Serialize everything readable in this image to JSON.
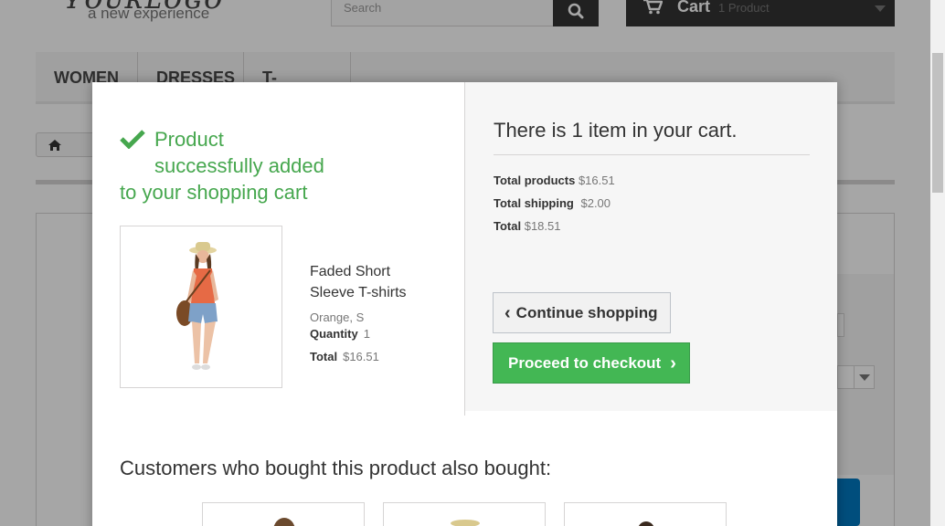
{
  "header": {
    "logo_tagline": "a new experience",
    "search_placeholder": "Search",
    "cart_label": "Cart",
    "cart_count": "1 Product"
  },
  "menu": {
    "items": [
      {
        "label": "WOMEN"
      },
      {
        "label": "DRESSES"
      },
      {
        "label": "T-SHIRTS"
      }
    ]
  },
  "modal": {
    "success_line1": "Product",
    "success_line1b": "successfully added",
    "success_line2": "to your shopping cart",
    "product": {
      "name": "Faded Short Sleeve T-shirts",
      "attributes": "Orange, S",
      "quantity_label": "Quantity",
      "quantity_value": "1",
      "total_label": "Total",
      "total_value": "$16.51"
    },
    "cart": {
      "heading": "There is 1 item in your cart.",
      "total_products_label": "Total products",
      "total_products_value": "$16.51",
      "total_shipping_label": "Total shipping",
      "total_shipping_value": "$2.00",
      "total_label": "Total",
      "total_value": "$18.51"
    },
    "continue_label": "Continue shopping",
    "checkout_label": "Proceed to checkout",
    "crossselling_title": "Customers who bought this product also bought:"
  },
  "colors": {
    "success_green": "#46a74e",
    "checkout_green": "#43b754",
    "dark": "#333333"
  },
  "icons": [
    "home-icon",
    "search-icon",
    "cart-icon",
    "check-icon",
    "close-icon",
    "chevron-left-icon",
    "chevron-right-icon"
  ]
}
